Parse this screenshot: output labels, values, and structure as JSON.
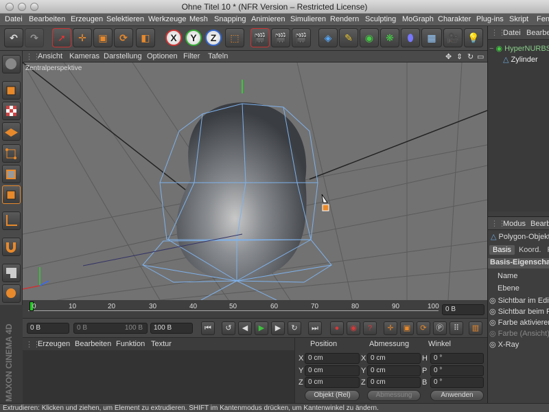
{
  "window": {
    "title": "Ohne Titel 10 * (NFR Version – Restricted License)"
  },
  "menu": [
    "Datei",
    "Bearbeiten",
    "Erzeugen",
    "Selektieren",
    "Werkzeuge",
    "Mesh",
    "Snapping",
    "Animieren",
    "Simulieren",
    "Rendern",
    "Sculpting",
    "MoGraph",
    "Charakter",
    "Plug-ins",
    "Skript",
    "Fenster"
  ],
  "viewport": {
    "menu": [
      "Ansicht",
      "Kameras",
      "Darstellung",
      "Optionen",
      "Filter",
      "Tafeln"
    ],
    "label": "Zentralperspektive"
  },
  "timeline": {
    "ticks": [
      "0",
      "10",
      "20",
      "30",
      "40",
      "50",
      "60",
      "70",
      "80",
      "90",
      "100"
    ],
    "end_field": "0 B"
  },
  "transport": {
    "start": "0 B",
    "current": "0 B",
    "range_end": "100 B",
    "end": "100 B"
  },
  "material": {
    "menu": [
      "Erzeugen",
      "Bearbeiten",
      "Funktion",
      "Textur"
    ]
  },
  "coords": {
    "headers": [
      "Position",
      "Abmessung",
      "Winkel"
    ],
    "rows": [
      {
        "axis": "X",
        "pos": "0 cm",
        "size": "0 cm",
        "rot_axis": "H",
        "rot": "0 °"
      },
      {
        "axis": "Y",
        "pos": "0 cm",
        "size": "0 cm",
        "rot_axis": "P",
        "rot": "0 °"
      },
      {
        "axis": "Z",
        "pos": "0 cm",
        "size": "0 cm",
        "rot_axis": "B",
        "rot": "0 °"
      }
    ],
    "mode_select": "Objekt (Rel)",
    "size_select": "Abmessung",
    "apply": "Anwenden"
  },
  "objects": {
    "menu": [
      "Datei",
      "Bearbeiten"
    ],
    "items": [
      "HyperNURBS",
      "Zylinder"
    ]
  },
  "attributes": {
    "menu": [
      "Modus",
      "Bearbeiten"
    ],
    "object_title": "Polygon-Objekt",
    "tabs": [
      "Basis",
      "Koord.",
      "Ph"
    ],
    "section": "Basis-Eigenschaften",
    "fields": [
      "Name",
      "Ebene",
      "Sichtbar im Editor",
      "Sichtbar beim Rendern",
      "Farbe aktivieren",
      "Farbe (Ansicht)",
      "X-Ray"
    ]
  },
  "branding": "MAXON CINEMA 4D",
  "status": "Extrudieren: Klicken und ziehen, um Element zu extrudieren. SHIFT im Kantenmodus drücken, um Kantenwinkel zu ändern.",
  "colors": {
    "accent_orange": "#e8892b",
    "mesh_blue": "#6fa8dc",
    "play_green": "#3fbf3f",
    "record_red": "#d43a3a"
  }
}
